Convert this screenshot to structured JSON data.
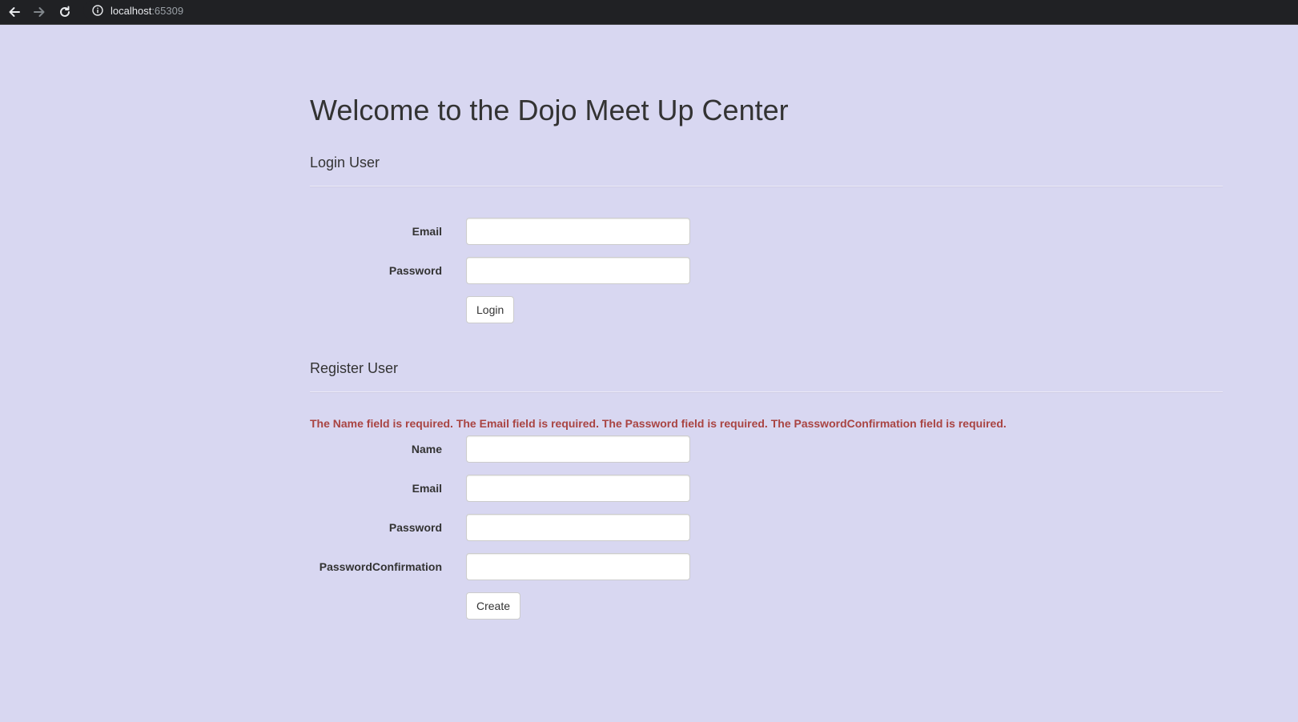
{
  "browser": {
    "url_host": "localhost",
    "url_port": ":65309"
  },
  "page": {
    "title": "Welcome to the Dojo Meet Up Center"
  },
  "login": {
    "heading": "Login User",
    "email_label": "Email",
    "email_value": "",
    "password_label": "Password",
    "password_value": "",
    "submit_label": "Login"
  },
  "register": {
    "heading": "Register User",
    "validation_message": "The Name field is required. The Email field is required. The Password field is required. The PasswordConfirmation field is required.",
    "name_label": "Name",
    "name_value": "",
    "email_label": "Email",
    "email_value": "",
    "password_label": "Password",
    "password_value": "",
    "confirm_label": "PasswordConfirmation",
    "confirm_value": "",
    "submit_label": "Create"
  },
  "colors": {
    "page_background": "#d8d7f1",
    "error_text": "#a94442",
    "browser_chrome": "#202124"
  }
}
